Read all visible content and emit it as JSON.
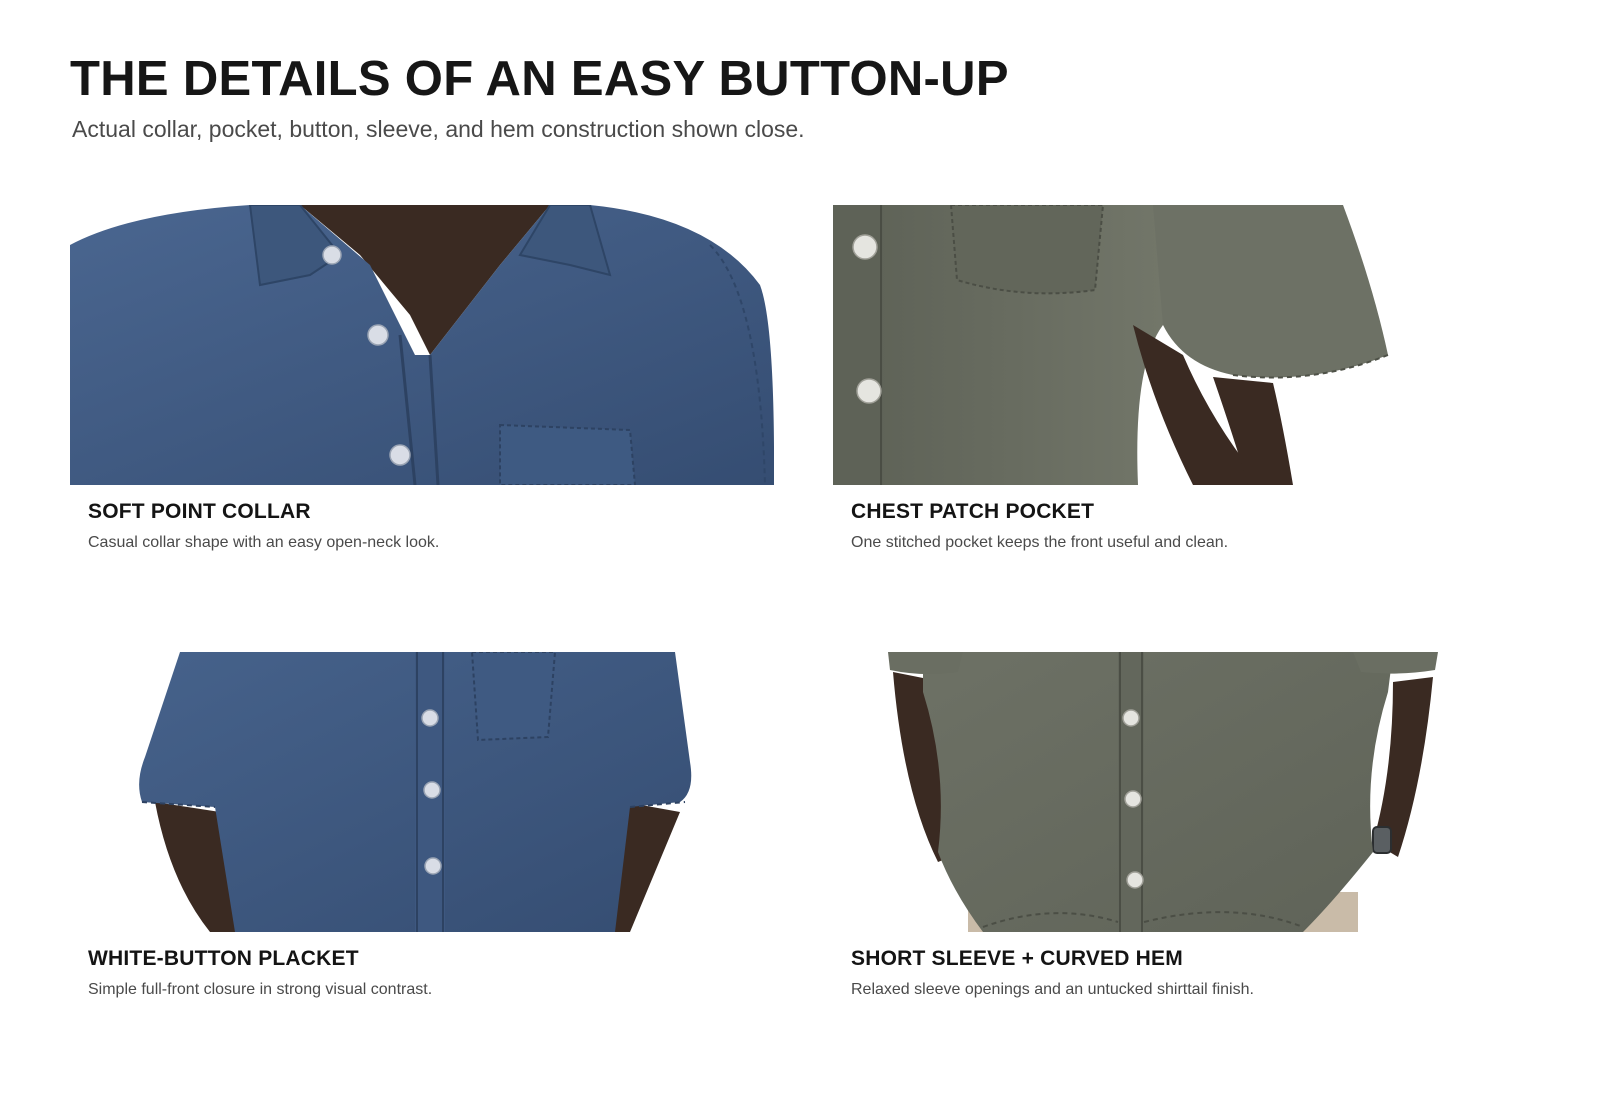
{
  "header": {
    "title": "THE DETAILS OF AN EASY BUTTON-UP",
    "subtitle": "Actual collar, pocket, button, sleeve, and hem construction shown close."
  },
  "features": [
    {
      "title": "SOFT POINT COLLAR",
      "description": "Casual collar shape with an easy open-neck look.",
      "image": "blue-shirt-collar-closeup",
      "shirt_color": "#3f5a80"
    },
    {
      "title": "CHEST PATCH POCKET",
      "description": "One stitched pocket keeps the front useful and clean.",
      "image": "olive-shirt-pocket-closeup",
      "shirt_color": "#676b5f"
    },
    {
      "title": "WHITE-BUTTON PLACKET",
      "description": "Simple full-front closure in strong visual contrast.",
      "image": "blue-shirt-placket-closeup",
      "shirt_color": "#3f5a80"
    },
    {
      "title": "SHORT SLEEVE + CURVED HEM",
      "description": "Relaxed sleeve openings and an untucked shirttail finish.",
      "image": "olive-shirt-sleeve-hem-closeup",
      "shirt_color": "#676b5f"
    }
  ]
}
